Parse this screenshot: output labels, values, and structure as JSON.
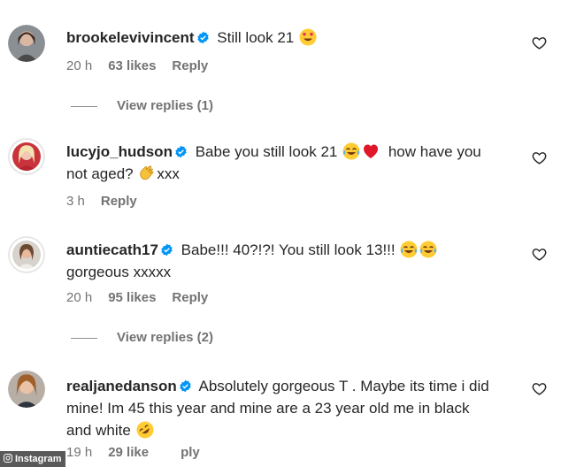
{
  "comments": [
    {
      "username": "brookelevivincent",
      "text": "Still look 21",
      "text_after": "",
      "emojis": [
        "heart-eyes-emoji"
      ],
      "time": "20 h",
      "likes": "63 likes",
      "reply": "Reply",
      "view_replies": "View replies (1)"
    },
    {
      "username": "lucyjo_hudson",
      "text": "Babe you still look 21",
      "text_mid": "how have you",
      "text_line2": "not aged?",
      "text_after": "xxx",
      "emojis": [
        "tears-of-joy-emoji",
        "red-heart-emoji",
        "clapping-hands-emoji"
      ],
      "time": "3 h",
      "reply": "Reply"
    },
    {
      "username": "auntiecath17",
      "text": "Babe!!! 40?!?! You still look 13!!!",
      "text_line2": "gorgeous xxxxx",
      "emojis": [
        "tears-of-joy-emoji",
        "tears-of-joy-emoji"
      ],
      "time": "20 h",
      "likes": "95 likes",
      "reply": "Reply",
      "view_replies": "View replies (2)"
    },
    {
      "username": "realjanedanson",
      "text": "Absolutely gorgeous T . Maybe its time i did",
      "text_line2": "mine! Im 45 this year and mine are a 23 year old me in black",
      "text_line3": "and white",
      "emojis": [
        "rolling-laughing-emoji"
      ],
      "time": "19 h",
      "likes": "29 like",
      "reply": "ply"
    }
  ],
  "watermark": "Instagram",
  "colors": {
    "text": "#262626",
    "meta": "#737373",
    "verified": "#0095f6",
    "background": "#ffffff"
  },
  "icons": [
    "verified-badge-icon",
    "heart-outline-icon",
    "avatar"
  ]
}
